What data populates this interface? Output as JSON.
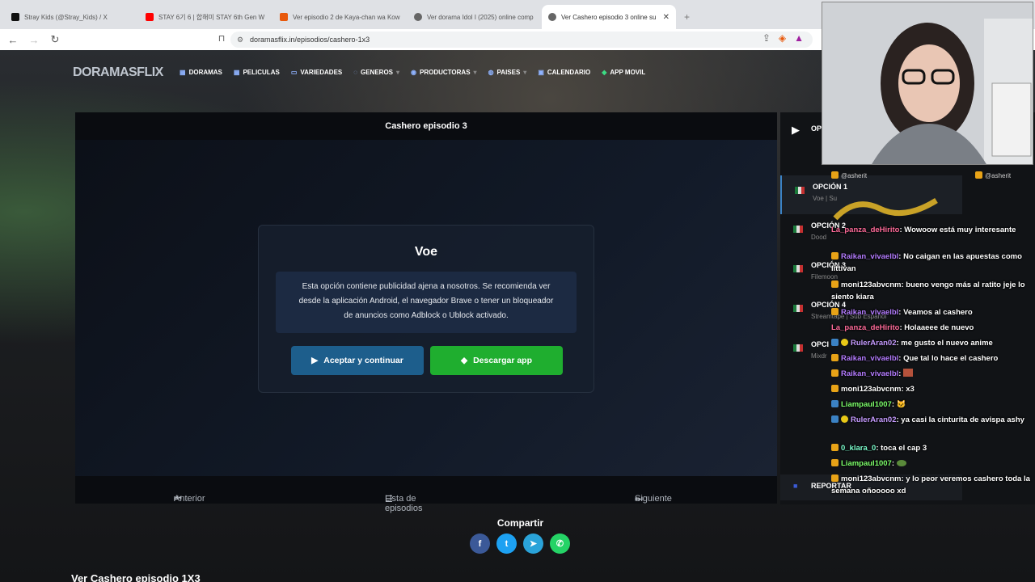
{
  "browser": {
    "tabs": [
      {
        "title": "Stray Kids (@Stray_Kids) / X",
        "icon_color": "#111111"
      },
      {
        "title": "STAY 6기 6 | 합해미 STAY 6th Gen W",
        "icon_color": "#ff0000"
      },
      {
        "title": "Ver episodio 2 de Kaya-chan wa Kow",
        "icon_color": "#e8590c"
      },
      {
        "title": "Ver dorama Idol I (2025) online comp",
        "icon_color": "#666666"
      },
      {
        "title": "Ver Cashero episodio 3 online su",
        "icon_color": "#666666"
      }
    ],
    "close_tab": "✕",
    "new_tab": "+",
    "url": "doramasflix.in/episodios/cashero-1x3"
  },
  "site": {
    "logo": "DORAMASFLIX",
    "menu": [
      {
        "label": "DORAMAS",
        "icon": "▦"
      },
      {
        "label": "PELICULAS",
        "icon": "▦"
      },
      {
        "label": "VARIEDADES",
        "icon": "▭"
      },
      {
        "label": "GENEROS",
        "icon": "◌",
        "caret": "▾"
      },
      {
        "label": "PRODUCTORAS",
        "icon": "◉",
        "caret": "▾"
      },
      {
        "label": "PAISES",
        "icon": "◍",
        "caret": "▾"
      },
      {
        "label": "CALENDARIO",
        "icon": "▣"
      },
      {
        "label": "APP MOVIL",
        "icon": "◆"
      }
    ]
  },
  "player": {
    "title": "Cashero episodio 3",
    "modal_title": "Voe",
    "notice_lines": [
      "Esta opción contiene publicidad ajena a nosotros. Se recomienda ver",
      "desde la aplicación Android, el navegador Brave o tener un bloqueador",
      "de anuncios como Adblock o Ublock activado."
    ],
    "accept_label": "Aceptar y continuar",
    "download_label": "Descargar app",
    "prev_label": "Anterior",
    "list_label": "Lista de episodios",
    "next_label": "Siguiente"
  },
  "options": {
    "header": "OP",
    "items": [
      {
        "title": "OPCIÓN 1",
        "sub": "Voe | Su"
      },
      {
        "title": "OPCIÓN 2",
        "sub": "Dood"
      },
      {
        "title": "OPCIÓN 3",
        "sub": "Filemoon"
      },
      {
        "title": "OPCIÓN 4",
        "sub": "Streamtape | Sub Español"
      },
      {
        "title": "OPCI",
        "sub": "Mixdr"
      }
    ],
    "report": "REPORTAR"
  },
  "share": {
    "title": "Compartir",
    "networks": [
      {
        "name": "facebook",
        "glyph": "f",
        "color": "#3b5998"
      },
      {
        "name": "twitter",
        "glyph": "t",
        "color": "#1da1f2"
      },
      {
        "name": "telegram",
        "glyph": "➤",
        "color": "#2aa3d9"
      },
      {
        "name": "whatsapp",
        "glyph": "✆",
        "color": "#25d366"
      }
    ]
  },
  "page_heading": "Ver Cashero episodio 1X3",
  "chat": {
    "handle_left": "@asherit",
    "handle_right": "@asherit",
    "messages": [
      {
        "user": "La_panza_deHirito",
        "text": ": Wowoow está muy interesante",
        "color": "#ff6b9a",
        "badge": "b1"
      },
      {
        "user": "Raikan_vivaelbl",
        "text": ": No caigan en las apuestas como littivan",
        "color": "#b47cff",
        "badge": "b1"
      },
      {
        "user": "moni123abvcnm",
        "text": ": bueno vengo más al ratito jeje lo siento kiara",
        "color": "#ffffff",
        "badge": "b1"
      },
      {
        "user": "Raikan_vivaelbl",
        "text": ": Veamos al cashero",
        "color": "#b47cff",
        "badge": "b1"
      },
      {
        "user": "La_panza_deHirito",
        "text": ": Holaaeee de nuevo",
        "color": "#ff6b9a",
        "badge": "b1"
      },
      {
        "user": "RulerAran02",
        "text": ": me gusto el nuevo anime",
        "color": "#c59bff",
        "badge": "b2"
      },
      {
        "user": "Raikan_vivaelbl",
        "text": ": Que tal lo hace el cashero",
        "color": "#b47cff",
        "badge": "b1"
      },
      {
        "user": "Raikan_vivaelbl",
        "text": ":",
        "color": "#b47cff",
        "badge": "b1"
      },
      {
        "user": "moni123abvcnm",
        "text": ": x3",
        "color": "#ffffff",
        "badge": "b1"
      },
      {
        "user": "Liampaul1007",
        "text": ":",
        "color": "#7dff6b",
        "badge": "b2"
      },
      {
        "user": "RulerAran02",
        "text": ": ya casi la cinturita de avispa ashy",
        "color": "#c59bff",
        "badge": "b2"
      },
      {
        "user": "0_klara_0",
        "text": ": toca el cap 3",
        "color": "#7dffcf",
        "badge": "b1"
      },
      {
        "user": "Liampaul1007",
        "text": ":",
        "color": "#7dff6b",
        "badge": "b1"
      },
      {
        "user": "moni123abvcnm",
        "text": ": y lo peor veremos cashero toda la semana oñooooo xd",
        "color": "#ffffff",
        "badge": "b1"
      }
    ]
  }
}
